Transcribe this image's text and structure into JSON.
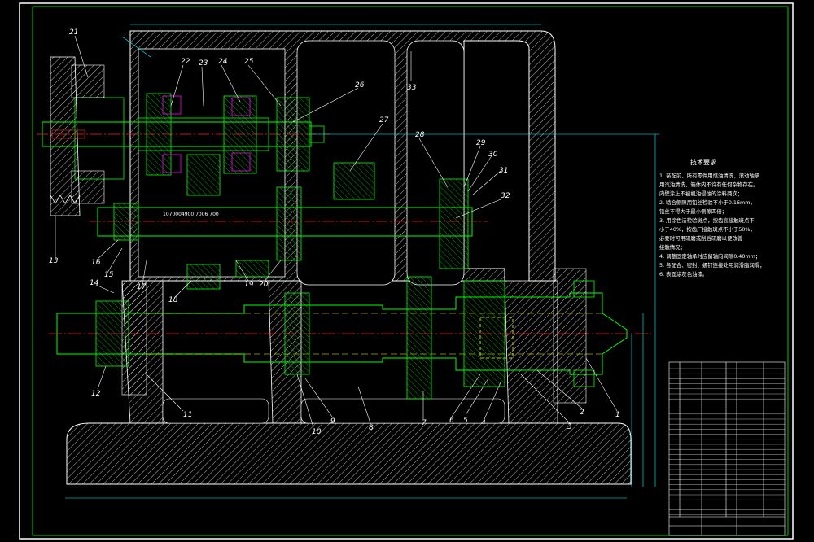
{
  "drawing": {
    "part_numbers": [
      "1",
      "2",
      "3",
      "4",
      "5",
      "6",
      "7",
      "8",
      "9",
      "10",
      "11",
      "12",
      "13",
      "14",
      "15",
      "16",
      "17",
      "18",
      "19",
      "20",
      "21",
      "22",
      "23",
      "24",
      "25",
      "26",
      "27",
      "28",
      "29",
      "30",
      "31",
      "32",
      "33"
    ],
    "notes_title": "技术要求",
    "notes": [
      "1. 装配前，所有零件用煤油清洗，滚动轴承",
      "   用汽油清洗，箱体内不许有任何杂物存在。",
      "   内壁涂上不被机油侵蚀的涂料两次；",
      "2. 啮合侧隙用铅丝检验不小于0.16mm，",
      "   铅丝不得大于最小侧隙四倍；",
      "3. 用涂色法检验斑点，按齿高接触斑点不",
      "   小于40%，按齿厂接触斑点不小于50%，",
      "   必要时可用研磨或刮后研磨以便改善",
      "   接触情况；",
      "4. 调整固定轴承时应留轴向间隙0.40mm；",
      "5. 各配合、密封、螺钉连接处用润滑脂润滑；",
      "6. 表面涂灰色油漆。"
    ],
    "colors": {
      "outline": "#00ff00",
      "center": "#ff2020",
      "gear": "#ff00ff",
      "dim": "#00ffff",
      "white": "#ffffff",
      "yellow": "#ffff00"
    }
  }
}
